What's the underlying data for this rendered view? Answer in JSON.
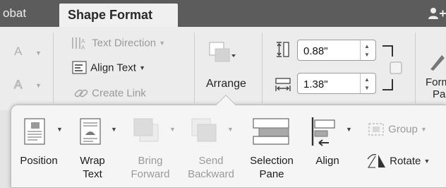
{
  "tabs": {
    "previous": "obat",
    "active": "Shape Format"
  },
  "ribbon": {
    "text_direction": "Text Direction",
    "align_text": "Align Text",
    "create_link": "Create Link",
    "arrange": "Arrange",
    "height_value": "0.88\"",
    "width_value": "1.38\"",
    "format_pane_line1": "Form",
    "format_pane_line2": "Pa"
  },
  "arrange_menu": {
    "position": "Position",
    "wrap_text_1": "Wrap",
    "wrap_text_2": "Text",
    "bring_forward_1": "Bring",
    "bring_forward_2": "Forward",
    "send_backward_1": "Send",
    "send_backward_2": "Backward",
    "selection_pane_1": "Selection",
    "selection_pane_2": "Pane",
    "align": "Align",
    "group": "Group",
    "rotate": "Rotate"
  },
  "icons": {
    "font_color": "font-a-icon",
    "text_direction": "text-direction-icon",
    "align_text": "align-text-icon",
    "link": "link-icon",
    "arrange": "arrange-icon",
    "height": "shape-height-icon",
    "width": "shape-width-icon",
    "share": "add-person-icon",
    "rotate": "rotate-icon"
  },
  "colors": {
    "tabbar": "#5c5c5c",
    "ribbon": "#ececec",
    "disabled_text": "#9a9a9a"
  }
}
